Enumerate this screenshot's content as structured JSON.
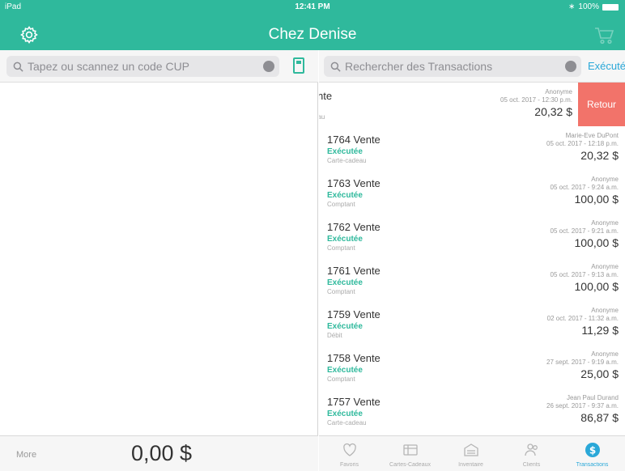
{
  "status_bar": {
    "device": "iPad",
    "time": "12:41 PM",
    "battery": "100%"
  },
  "header": {
    "title": "Chez Denise",
    "settings_icon": "gear-icon",
    "cart_icon": "cart-icon"
  },
  "left_pane": {
    "search": {
      "placeholder": "Tapez ou scannez un code CUP"
    },
    "footer": {
      "more_label": "More",
      "total": "0,00 $"
    }
  },
  "right_pane": {
    "search": {
      "placeholder": "Rechercher des Transactions"
    },
    "filter_label": "Exécutée",
    "swiped_row": {
      "num": "nte",
      "status": "",
      "method": "eau",
      "customer": "Anonyme",
      "date": "05 oct. 2017 - 12:30 p.m.",
      "amount": "20,32 $",
      "action": "Retour"
    },
    "transactions": [
      {
        "num": "1764 Vente",
        "status": "Exécutée",
        "method": "Carte-cadeau",
        "customer": "Marie-Eve DuPont",
        "date": "05 oct. 2017 - 12:18 p.m.",
        "amount": "20,32 $"
      },
      {
        "num": "1763 Vente",
        "status": "Exécutée",
        "method": "Comptant",
        "customer": "Anonyme",
        "date": "05 oct. 2017 - 9:24 a.m.",
        "amount": "100,00 $"
      },
      {
        "num": "1762 Vente",
        "status": "Exécutée",
        "method": "Comptant",
        "customer": "Anonyme",
        "date": "05 oct. 2017 - 9:21 a.m.",
        "amount": "100,00 $"
      },
      {
        "num": "1761 Vente",
        "status": "Exécutée",
        "method": "Comptant",
        "customer": "Anonyme",
        "date": "05 oct. 2017 - 9:13 a.m.",
        "amount": "100,00 $"
      },
      {
        "num": "1759 Vente",
        "status": "Exécutée",
        "method": "Débit",
        "customer": "Anonyme",
        "date": "02 oct. 2017 - 11:32 a.m.",
        "amount": "11,29 $"
      },
      {
        "num": "1758 Vente",
        "status": "Exécutée",
        "method": "Comptant",
        "customer": "Anonyme",
        "date": "27 sept. 2017 - 9:19 a.m.",
        "amount": "25,00 $"
      },
      {
        "num": "1757 Vente",
        "status": "Exécutée",
        "method": "Carte-cadeau",
        "customer": "Jean Paul Durand",
        "date": "26 sept. 2017 - 9:37 a.m.",
        "amount": "86,87 $"
      }
    ]
  },
  "tabbar": {
    "tabs": [
      {
        "label": "Favoris",
        "icon": "heart-icon"
      },
      {
        "label": "Cartes-Cadeaux",
        "icon": "gift-card-icon"
      },
      {
        "label": "Inventaire",
        "icon": "inventory-icon"
      },
      {
        "label": "Clients",
        "icon": "clients-icon"
      },
      {
        "label": "Transactions",
        "icon": "dollar-icon",
        "active": true
      }
    ]
  },
  "colors": {
    "accent": "#2fb99c",
    "link": "#2aa8d8",
    "danger": "#f2736a"
  }
}
